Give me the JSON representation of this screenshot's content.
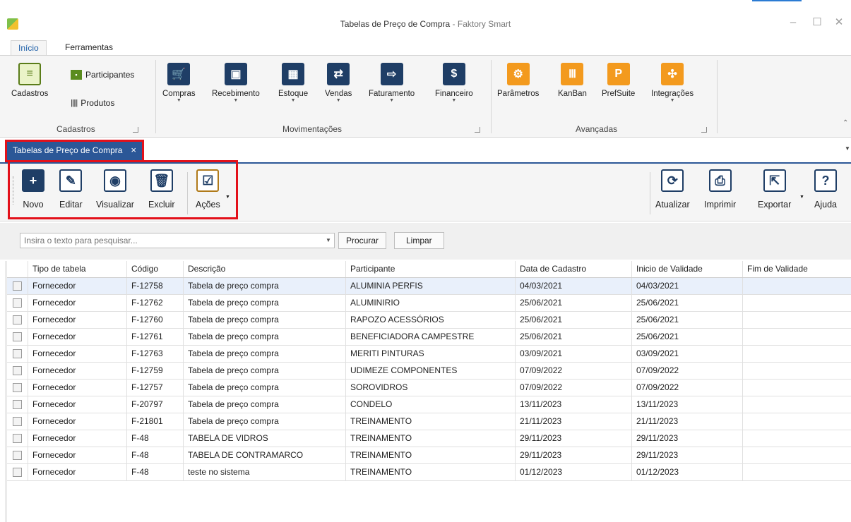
{
  "window": {
    "title": "Tabelas de Preço de Compra",
    "suffix": " - Faktory Smart",
    "minimize": "–",
    "maximize": "☐",
    "close": "✕"
  },
  "ribbon_tabs": [
    "Início",
    "Ferramentas"
  ],
  "ribbon": {
    "cadastros": {
      "big_label": "Cadastros",
      "participantes": "Participantes",
      "produtos": "Produtos",
      "group": "Cadastros"
    },
    "movimentacoes": {
      "items": [
        "Compras",
        "Recebimento",
        "Estoque",
        "Vendas",
        "Faturamento",
        "Financeiro"
      ],
      "group": "Movimentações"
    },
    "avancadas": {
      "items": [
        "Parâmetros",
        "KanBan",
        "PrefSuite",
        "Integrações"
      ],
      "group": "Avançadas"
    }
  },
  "doc_tab": {
    "label": "Tabelas de Preço de Compra",
    "close": "×"
  },
  "toolbar": {
    "left": [
      "Novo",
      "Editar",
      "Visualizar",
      "Excluir",
      "Ações"
    ],
    "right": [
      "Atualizar",
      "Imprimir",
      "Exportar",
      "Ajuda"
    ]
  },
  "search": {
    "placeholder": "Insira o texto para pesquisar...",
    "procurar": "Procurar",
    "limpar": "Limpar"
  },
  "grid": {
    "columns": [
      "Tipo de tabela",
      "Código",
      "Descrição",
      "Participante",
      "Data de Cadastro",
      "Inicio de Validade",
      "Fim de Validade"
    ],
    "rows": [
      [
        "Fornecedor",
        "F-12758",
        "Tabela de preço compra",
        "ALUMINIA PERFIS",
        "04/03/2021",
        "04/03/2021",
        ""
      ],
      [
        "Fornecedor",
        "F-12762",
        "Tabela de preço compra",
        "ALUMINIRIO",
        "25/06/2021",
        "25/06/2021",
        ""
      ],
      [
        "Fornecedor",
        "F-12760",
        "Tabela de preço compra",
        "RAPOZO ACESSÓRIOS",
        "25/06/2021",
        "25/06/2021",
        ""
      ],
      [
        "Fornecedor",
        "F-12761",
        "Tabela de preço compra",
        "BENEFICIADORA CAMPESTRE",
        "25/06/2021",
        "25/06/2021",
        ""
      ],
      [
        "Fornecedor",
        "F-12763",
        "Tabela de preço compra",
        "MERITI PINTURAS",
        "03/09/2021",
        "03/09/2021",
        ""
      ],
      [
        "Fornecedor",
        "F-12759",
        "Tabela de preço compra",
        "UDIMEZE COMPONENTES",
        "07/09/2022",
        "07/09/2022",
        ""
      ],
      [
        "Fornecedor",
        "F-12757",
        "Tabela de preço compra",
        "SOROVIDROS",
        "07/09/2022",
        "07/09/2022",
        ""
      ],
      [
        "Fornecedor",
        "F-20797",
        "Tabela de preço compra",
        "CONDELO",
        "13/11/2023",
        "13/11/2023",
        ""
      ],
      [
        "Fornecedor",
        "F-21801",
        "Tabela de preço compra",
        "TREINAMENTO",
        "21/11/2023",
        "21/11/2023",
        ""
      ],
      [
        "Fornecedor",
        "F-48",
        "TABELA DE VIDROS",
        "TREINAMENTO",
        "29/11/2023",
        "29/11/2023",
        ""
      ],
      [
        "Fornecedor",
        "F-48",
        "TABELA DE CONTRAMARCO",
        "TREINAMENTO",
        "29/11/2023",
        "29/11/2023",
        ""
      ],
      [
        "Fornecedor",
        "F-48",
        "teste no sistema",
        "TREINAMENTO",
        "01/12/2023",
        "01/12/2023",
        ""
      ]
    ]
  },
  "colors": {
    "accent": "#2b5797",
    "highlight_frame": "#e3101a",
    "ribbon_bg": "#f5f5f5",
    "selected_row": "#e9f0fb"
  }
}
